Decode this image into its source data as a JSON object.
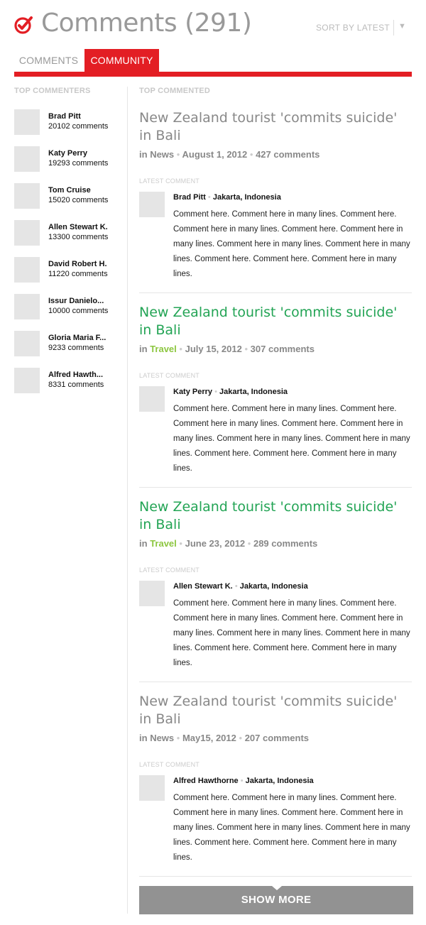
{
  "header": {
    "title": "Comments (291)",
    "sort_label": "SORT BY LATEST",
    "sort_arrow": "▼",
    "brand_color": "#e31e24",
    "logo_icon": "comment-check-icon"
  },
  "tabs": [
    {
      "label": "COMMENTS",
      "active": false
    },
    {
      "label": "COMMUNITY",
      "active": true
    }
  ],
  "sidebar": {
    "title": "TOP COMMENTERS",
    "commenters": [
      {
        "name": "Brad Pitt",
        "count": "20102 comments"
      },
      {
        "name": "Katy Perry",
        "count": "19293 comments"
      },
      {
        "name": "Tom Cruise",
        "count": "15020 comments"
      },
      {
        "name": "Allen Stewart K.",
        "count": "13300 comments"
      },
      {
        "name": "David Robert H.",
        "count": "11220 comments"
      },
      {
        "name": "Issur Danielo...",
        "count": "10000 comments"
      },
      {
        "name": "Gloria Maria F...",
        "count": "9233 comments"
      },
      {
        "name": "Alfred Hawth...",
        "count": "8331 comments"
      }
    ]
  },
  "main": {
    "title": "TOP COMMENTED",
    "latest_label": "LATEST COMMENT",
    "articles": [
      {
        "title": "New Zealand tourist 'commits suicide' in Bali",
        "color": "#888888",
        "in": "in",
        "category": "News",
        "date": "August 1, 2012",
        "comments": "427 comments",
        "commenter": "Brad Pitt",
        "location": "Jakarta, Indonesia",
        "body": "Comment here. Comment here in many lines. Comment here. Comment here in many lines. Comment here. Comment here in many lines. Comment here in many lines. Comment here in many lines. Comment here. Comment here. Comment here in many lines."
      },
      {
        "title": "New Zealand tourist 'commits suicide' in Bali",
        "color": "#23a455",
        "in": "in",
        "category": "Travel",
        "date": "July 15, 2012",
        "comments": "307 comments",
        "commenter": "Katy Perry",
        "location": "Jakarta, Indonesia",
        "body": "Comment here. Comment here in many lines. Comment here. Comment here in many lines. Comment here. Comment here in many lines. Comment here in many lines. Comment here in many lines. Comment here. Comment here. Comment here in many lines."
      },
      {
        "title": "New Zealand tourist 'commits suicide' in Bali",
        "color": "#23a455",
        "in": "in",
        "category": "Travel",
        "date": "June 23, 2012",
        "comments": "289 comments",
        "commenter": "Allen Stewart K.",
        "location": "Jakarta, Indonesia",
        "body": "Comment here. Comment here in many lines. Comment here. Comment here in many lines. Comment here. Comment here in many lines. Comment here in many lines. Comment here in many lines. Comment here. Comment here. Comment here in many lines."
      },
      {
        "title": "New Zealand tourist 'commits suicide' in Bali",
        "color": "#888888",
        "in": "in",
        "category": "News",
        "date": "May15, 2012",
        "comments": "207 comments",
        "commenter": "Alfred Hawthorne",
        "location": "Jakarta, Indonesia",
        "body": "Comment here. Comment here in many lines. Comment here. Comment here in many lines. Comment here. Comment here in many lines. Comment here in many lines. Comment here in many lines. Comment here. Comment here. Comment here in many lines."
      }
    ],
    "show_more": "SHOW MORE"
  }
}
